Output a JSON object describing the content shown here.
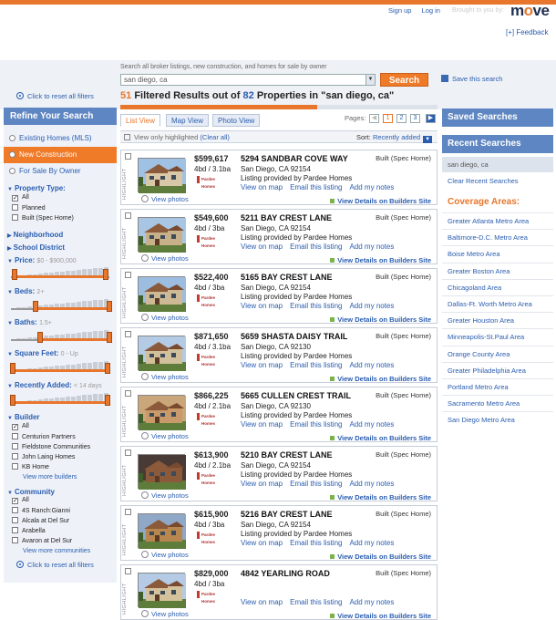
{
  "header": {
    "sign_up": "Sign up",
    "log_in": "Log in",
    "brought_by": "Brought to you by:",
    "logo": "move",
    "feedback": "[+] Feedback"
  },
  "search": {
    "hint": "Search all broker listings, new construction, and homes for sale by owner",
    "value": "san diego, ca",
    "button": "Search",
    "save": "Save this search"
  },
  "reset_filters": "Click to reset all filters",
  "results": {
    "filtered_count": "51",
    "text1": "Filtered Results out of",
    "total": "82",
    "text2": "Properties in \"san diego, ca\"",
    "progress_fraction": 0.62
  },
  "colors": {
    "accent": "#e8762c",
    "brand": "#5e86c2",
    "link": "#2a5db0"
  },
  "left": {
    "refine_title": "Refine Your Search",
    "mls": [
      {
        "label": "Existing Homes (MLS)",
        "selected": false
      },
      {
        "label": "New Construction",
        "selected": true
      },
      {
        "label": "For Sale By Owner",
        "selected": false
      }
    ],
    "property_type": {
      "title": "Property Type:",
      "options": [
        {
          "label": "All",
          "checked": true
        },
        {
          "label": "Planned",
          "checked": false
        },
        {
          "label": "Built (Spec Home)",
          "checked": false
        }
      ]
    },
    "neighborhood": "Neighborhood",
    "school_district": "School District",
    "price": {
      "title": "Price:",
      "range": "$0 - $900,000"
    },
    "beds": {
      "title": "Beds:",
      "range": "2+"
    },
    "baths": {
      "title": "Baths:",
      "range": "1.5+"
    },
    "sqft": {
      "title": "Square Feet:",
      "range": "0 - Up"
    },
    "recently": {
      "title": "Recently Added:",
      "range": "< 14 days"
    },
    "builder": {
      "title": "Builder",
      "options": [
        {
          "label": "All",
          "checked": true
        },
        {
          "label": "Centurion Partners",
          "checked": false
        },
        {
          "label": "Fieldstone Communities",
          "checked": false
        },
        {
          "label": "John Laing Homes",
          "checked": false
        },
        {
          "label": "KB Home",
          "checked": false
        }
      ],
      "more": "View more builders"
    },
    "community": {
      "title": "Community",
      "options": [
        {
          "label": "All",
          "checked": true
        },
        {
          "label": "4S Ranch:Gianni",
          "checked": false
        },
        {
          "label": "Alcala at Del Sur",
          "checked": false
        },
        {
          "label": "Arabella",
          "checked": false
        },
        {
          "label": "Avaron at Del Sur",
          "checked": false
        }
      ],
      "more": "View more communities"
    }
  },
  "tabs": [
    {
      "label": "List View",
      "active": true
    },
    {
      "label": "Map View",
      "active": false
    },
    {
      "label": "Photo View",
      "active": false
    }
  ],
  "pages": {
    "label": "Pages:",
    "items": [
      "1",
      "2",
      "3"
    ],
    "current": "1"
  },
  "filterbar": {
    "highlight": "View only highlighted",
    "clear": "(Clear all)",
    "sort_label": "Sort:",
    "sort_value": "Recently added"
  },
  "listing_common": {
    "highlight": "HIGHLIGHT",
    "view_photos": "View photos",
    "builder_logo": "Pardee Homes",
    "view_on_map": "View on map",
    "email": "Email this listing",
    "notes": "Add my notes",
    "view_details": "View Details on Builders Site",
    "built": "Built (Spec Home)"
  },
  "listings": [
    {
      "price": "$599,617",
      "bd": "4bd / 3.1ba",
      "address": "5294 SANDBAR COVE WAY",
      "city": "San Diego, CA 92154",
      "provider": "Listing provided by Pardee Homes"
    },
    {
      "price": "$549,600",
      "bd": "4bd / 3ba",
      "address": "5211 BAY CREST LANE",
      "city": "San Diego, CA 92154",
      "provider": "Listing provided by Pardee Homes"
    },
    {
      "price": "$522,400",
      "bd": "4bd / 3ba",
      "address": "5165 BAY CREST LANE",
      "city": "San Diego, CA 92154",
      "provider": "Listing provided by Pardee Homes"
    },
    {
      "price": "$871,650",
      "bd": "4bd / 3.1ba",
      "address": "5659 SHASTA DAISY TRAIL",
      "city": "San Diego, CA 92130",
      "provider": "Listing provided by Pardee Homes"
    },
    {
      "price": "$866,225",
      "bd": "4bd / 2.1ba",
      "address": "5665 CULLEN CREST TRAIL",
      "city": "San Diego, CA 92130",
      "provider": "Listing provided by Pardee Homes"
    },
    {
      "price": "$613,900",
      "bd": "4bd / 2.1ba",
      "address": "5210 BAY CREST LANE",
      "city": "San Diego, CA 92154",
      "provider": "Listing provided by Pardee Homes"
    },
    {
      "price": "$615,900",
      "bd": "4bd / 3ba",
      "address": "5216 BAY CREST LANE",
      "city": "San Diego, CA 92154",
      "provider": "Listing provided by Pardee Homes"
    },
    {
      "price": "$829,000",
      "bd": "4bd / 3ba",
      "address": "4842 YEARLING ROAD",
      "city": "",
      "provider": ""
    }
  ],
  "right": {
    "saved": "Saved Searches",
    "recent": "Recent Searches",
    "recent_item": "san diego, ca",
    "clear": "Clear Recent Searches",
    "coverage_title": "Coverage Areas:",
    "areas": [
      "Greater Atlanta Metro Area",
      "Baltimore-D.C. Metro Area",
      "Boise Metro Area",
      "Greater Boston Area",
      "Chicagoland Area",
      "Dallas-Ft. Worth Metro Area",
      "Greater Houston Area",
      "Minneapolis-St.Paul Area",
      "Orange County Area",
      "Greater Philadelphia Area",
      "Portland Metro Area",
      "Sacramento Metro Area",
      "San Diego Metro Area"
    ]
  }
}
